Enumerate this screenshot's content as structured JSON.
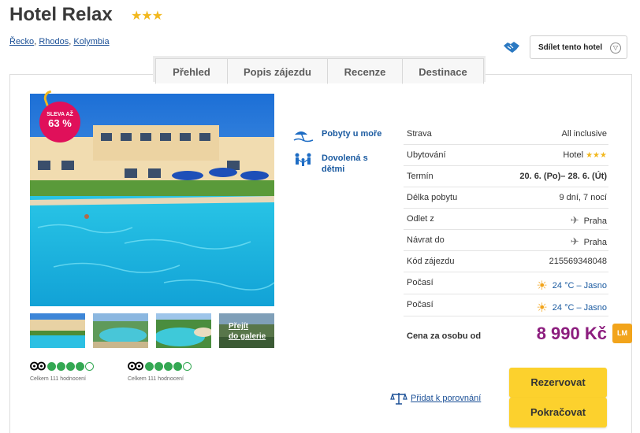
{
  "hotel": {
    "name": "Hotel Relax",
    "stars": 3,
    "stars_glyph": "★★★"
  },
  "breadcrumb": [
    "Řecko",
    "Rhodos",
    "Kolymbia"
  ],
  "breadcrumb_sep": ",",
  "share": {
    "label": "Sdílet tento hotel"
  },
  "tabs": [
    "Přehled",
    "Popis zájezdu",
    "Recenze",
    "Destinace"
  ],
  "badge": {
    "line1": "SLEVA AŽ",
    "line2": "63 %"
  },
  "gallery": {
    "label_line1": "Přejít",
    "label_line2": "do galerie"
  },
  "tripadvisor": [
    {
      "rating": 4,
      "max": 5,
      "count_text": "Celkem 111 hodnocení"
    },
    {
      "rating": 4,
      "max": 5,
      "count_text": "Celkem 111 hodnocení"
    }
  ],
  "features": [
    {
      "icon": "beach-umbrella-icon",
      "label": "Pobyty u moře"
    },
    {
      "icon": "family-icon",
      "label": "Dovolená s dětmi"
    }
  ],
  "details": {
    "board": {
      "key": "Strava",
      "value": "All inclusive"
    },
    "accommodation": {
      "key": "Ubytování",
      "value": "Hotel",
      "stars": "★★★"
    },
    "term": {
      "key": "Termín",
      "value": "20. 6. (Po)– 28. 6. (Út)"
    },
    "length": {
      "key": "Délka pobytu",
      "value": "9 dní, 7 nocí"
    },
    "departure": {
      "key": "Odlet z",
      "value": "Praha"
    },
    "return": {
      "key": "Návrat do",
      "value": "Praha"
    },
    "code": {
      "key": "Kód zájezdu",
      "value": "215569348048"
    },
    "weather1": {
      "key": "Počasí",
      "value": "24 °C – Jasno"
    },
    "weather2": {
      "key": "Počasí",
      "value": "24 °C – Jasno"
    },
    "price": {
      "key": "Cena za osobu od",
      "value": "8 990 Kč",
      "tag": "LM"
    }
  },
  "actions": {
    "compare": "Přidat k porovnání",
    "reserve": "Rezervovat",
    "continue": "Pokračovat"
  },
  "colors": {
    "price": "#8c1d7e",
    "button": "#fcd12d",
    "badge": "#e0105a",
    "link": "#1a4f96",
    "tripadvisor": "#34a853",
    "lm": "#f2a41b"
  }
}
